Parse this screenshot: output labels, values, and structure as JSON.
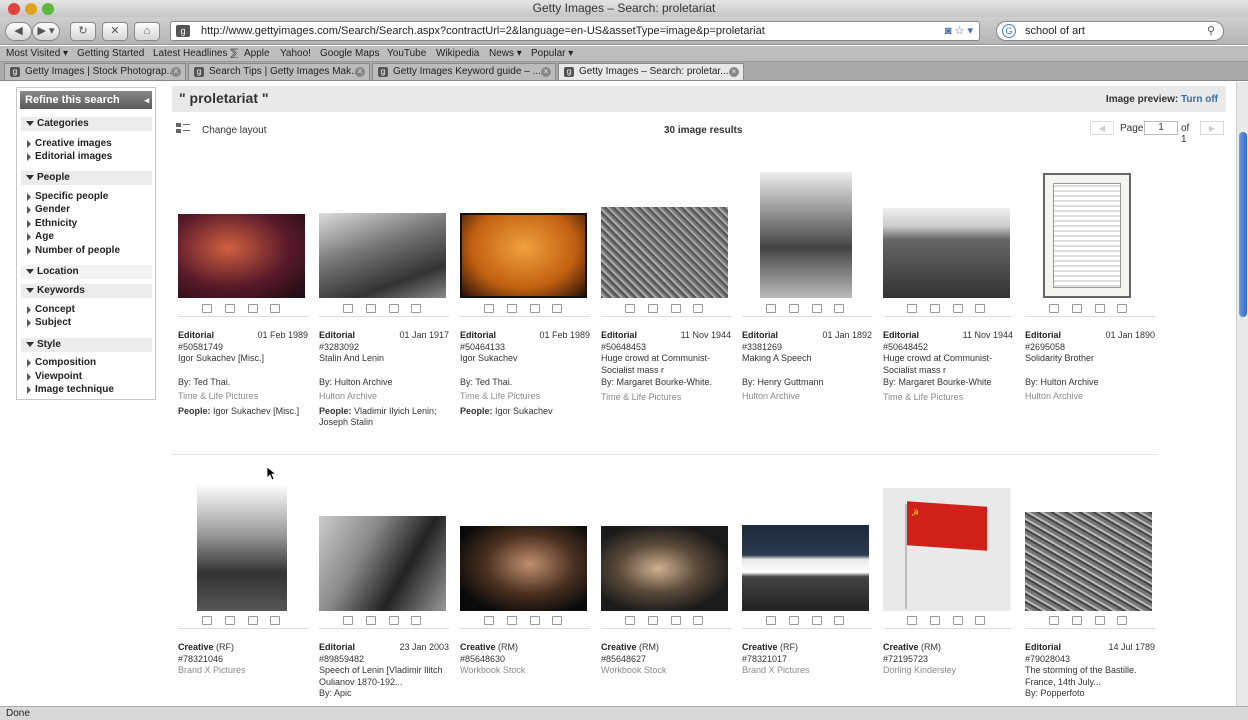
{
  "window": {
    "title": "Getty Images – Search: proletariat"
  },
  "toolbar": {
    "url": "http://www.gettyimages.com/Search/Search.aspx?contractUrl=2&language=en-US&assetType=image&p=proletariat",
    "search_value": "school of art"
  },
  "bookmarks": [
    "Most Visited ▾",
    "Getting Started",
    "Latest Headlines ⅀",
    "Apple",
    "Yahoo!",
    "Google Maps",
    "YouTube",
    "Wikipedia",
    "News ▾",
    "Popular ▾"
  ],
  "tabs": [
    {
      "label": "Getty Images | Stock Photograp..."
    },
    {
      "label": "Search Tips | Getty Images Mak..."
    },
    {
      "label": "Getty Images Keyword guide – ..."
    },
    {
      "label": "Getty Images – Search: proletar..."
    }
  ],
  "sidebar": {
    "title": "Refine this search",
    "sections": [
      {
        "heading": "Categories",
        "items": [
          "Creative images",
          "Editorial images"
        ]
      },
      {
        "heading": "People",
        "items": [
          "Specific people",
          "Gender",
          "Ethnicity",
          "Age",
          "Number of people"
        ]
      },
      {
        "heading": "Location",
        "items": []
      },
      {
        "heading": "Keywords",
        "items": [
          "Concept",
          "Subject"
        ]
      },
      {
        "heading": "Style",
        "items": [
          "Composition",
          "Viewpoint",
          "Image technique"
        ]
      }
    ]
  },
  "main": {
    "query": "\" proletariat \"",
    "preview_label": "Image preview:",
    "preview_link": "Turn off",
    "change_layout": "Change layout",
    "results": "30 image results",
    "page_label": "Page",
    "page_value": "1",
    "page_of": "of 1"
  },
  "results_row1": [
    {
      "type": "Editorial",
      "date": "01 Feb 1989",
      "id": "#50581749",
      "title": "Igor Sukachev [Misc.]",
      "by": "By: Ted Thai.",
      "coll": "Time & Life Pictures",
      "people_label": "People:",
      "people": "Igor Sukachev [Misc.]"
    },
    {
      "type": "Editorial",
      "date": "01 Jan 1917",
      "id": "#3283092",
      "title": "Stalin And Lenin",
      "by": "By: Hulton Archive",
      "coll": "Hulton Archive",
      "people_label": "People:",
      "people": "Vladimir Ilyich Lenin; Joseph Stalin"
    },
    {
      "type": "Editorial",
      "date": "01 Feb 1989",
      "id": "#50464133",
      "title": "Igor Sukachev",
      "by": "By: Ted Thai.",
      "coll": "Time & Life Pictures",
      "people_label": "People:",
      "people": "Igor Sukachev"
    },
    {
      "type": "Editorial",
      "date": "11 Nov 1944",
      "id": "#50648453",
      "title": "Huge crowd at Communist-Socialist mass r",
      "by": "By: Margaret Bourke-White.",
      "coll": "Time & Life Pictures",
      "people_label": "",
      "people": ""
    },
    {
      "type": "Editorial",
      "date": "01 Jan 1892",
      "id": "#3381269",
      "title": "Making A Speech",
      "by": "By: Henry Guttmann",
      "coll": "Hulton Archive",
      "people_label": "",
      "people": ""
    },
    {
      "type": "Editorial",
      "date": "11 Nov 1944",
      "id": "#50648452",
      "title": "Huge crowd at Communist-Socialist mass r",
      "by": "By: Margaret Bourke-White",
      "coll": "Time & Life Pictures",
      "people_label": "",
      "people": ""
    },
    {
      "type": "Editorial",
      "date": "01 Jan 1890",
      "id": "#2695058",
      "title": "Solidarity Brother",
      "by": "By: Hulton Archive",
      "coll": "Hulton Archive",
      "people_label": "",
      "people": ""
    }
  ],
  "results_row2": [
    {
      "type": "Creative",
      "sub": "(RF)",
      "date": "",
      "id": "#78321046",
      "title": "Brand X Pictures",
      "by": ""
    },
    {
      "type": "Editorial",
      "sub": "",
      "date": "23 Jan 2003",
      "id": "#89859482",
      "title": "Speech of Lenin [Vladimir Ilitch Oulianov 1870-192...",
      "by": "By: Apic"
    },
    {
      "type": "Creative",
      "sub": "(RM)",
      "date": "",
      "id": "#85648630",
      "title": "Workbook Stock",
      "by": ""
    },
    {
      "type": "Creative",
      "sub": "(RM)",
      "date": "",
      "id": "#85648627",
      "title": "Workbook Stock",
      "by": ""
    },
    {
      "type": "Creative",
      "sub": "(RF)",
      "date": "",
      "id": "#78321017",
      "title": "Brand X Pictures",
      "by": ""
    },
    {
      "type": "Creative",
      "sub": "(RM)",
      "date": "",
      "id": "#72195723",
      "title": "Dorling Kindersley",
      "by": ""
    },
    {
      "type": "Editorial",
      "sub": "",
      "date": "14 Jul 1789",
      "id": "#79028043",
      "title": "The storming of the Bastille. France, 14th July...",
      "by": "By: Popperfoto"
    }
  ],
  "status": {
    "text": "Done"
  }
}
